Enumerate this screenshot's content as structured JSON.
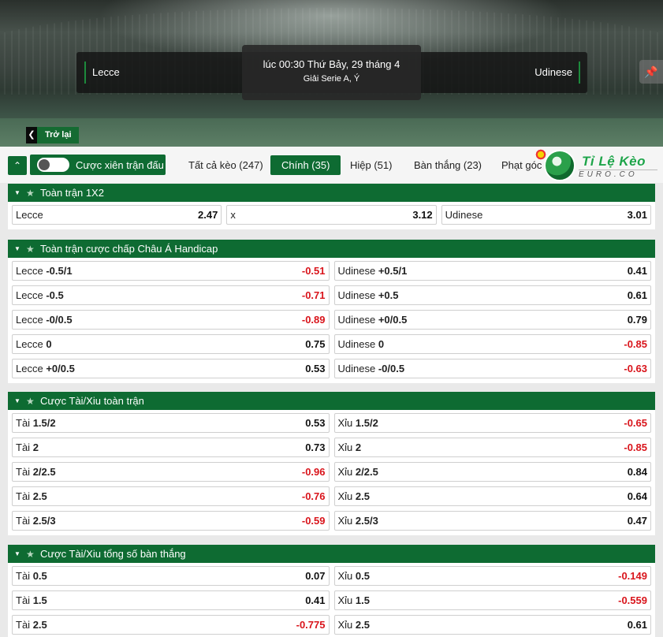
{
  "hero": {
    "home_team": "Lecce",
    "away_team": "Udinese",
    "kickoff": "lúc 00:30 Thứ Bảy, 29 tháng 4",
    "league": "Giải Serie A, Ý",
    "back_label": "Trở lại",
    "pin_icon": "pin-icon"
  },
  "toolbar": {
    "collapse_icon": "double-chevron-up-icon",
    "parlay_label": "Cược xiên trận đấu",
    "tabs": [
      {
        "label": "Tất cả kèo (247)"
      },
      {
        "label": "Chính (35)",
        "active": true
      },
      {
        "label": "Hiệp (51)"
      },
      {
        "label": "Bàn thắng (23)"
      },
      {
        "label": "Phạt góc (10)"
      }
    ]
  },
  "logo": {
    "brand": "Tỉ Lệ Kèo",
    "sub": "EURO.CO"
  },
  "colors": {
    "accent": "#0e6b32",
    "negative": "#d9141b"
  },
  "sections": [
    {
      "title": "Toàn trận 1X2",
      "cols": 3,
      "rows": [
        [
          {
            "label": "Lecce",
            "line": "",
            "odd": "2.47"
          },
          {
            "label": "x",
            "line": "",
            "odd": "3.12"
          },
          {
            "label": "Udinese",
            "line": "",
            "odd": "3.01"
          }
        ]
      ]
    },
    {
      "title": "Toàn trận cược chấp Châu Á Handicap",
      "cols": 2,
      "rows": [
        [
          {
            "label": "Lecce",
            "line": "-0.5/1",
            "odd": "-0.51"
          },
          {
            "label": "Udinese",
            "line": "+0.5/1",
            "odd": "0.41"
          }
        ],
        [
          {
            "label": "Lecce",
            "line": "-0.5",
            "odd": "-0.71"
          },
          {
            "label": "Udinese",
            "line": "+0.5",
            "odd": "0.61"
          }
        ],
        [
          {
            "label": "Lecce",
            "line": "-0/0.5",
            "odd": "-0.89"
          },
          {
            "label": "Udinese",
            "line": "+0/0.5",
            "odd": "0.79"
          }
        ],
        [
          {
            "label": "Lecce",
            "line": "0",
            "odd": "0.75"
          },
          {
            "label": "Udinese",
            "line": "0",
            "odd": "-0.85"
          }
        ],
        [
          {
            "label": "Lecce",
            "line": "+0/0.5",
            "odd": "0.53"
          },
          {
            "label": "Udinese",
            "line": "-0/0.5",
            "odd": "-0.63"
          }
        ]
      ]
    },
    {
      "title": "Cược Tài/Xiu toàn trận",
      "cols": 2,
      "rows": [
        [
          {
            "label": "Tài",
            "line": "1.5/2",
            "odd": "0.53"
          },
          {
            "label": "Xỉu",
            "line": "1.5/2",
            "odd": "-0.65"
          }
        ],
        [
          {
            "label": "Tài",
            "line": "2",
            "odd": "0.73"
          },
          {
            "label": "Xỉu",
            "line": "2",
            "odd": "-0.85"
          }
        ],
        [
          {
            "label": "Tài",
            "line": "2/2.5",
            "odd": "-0.96"
          },
          {
            "label": "Xỉu",
            "line": "2/2.5",
            "odd": "0.84"
          }
        ],
        [
          {
            "label": "Tài",
            "line": "2.5",
            "odd": "-0.76"
          },
          {
            "label": "Xỉu",
            "line": "2.5",
            "odd": "0.64"
          }
        ],
        [
          {
            "label": "Tài",
            "line": "2.5/3",
            "odd": "-0.59"
          },
          {
            "label": "Xỉu",
            "line": "2.5/3",
            "odd": "0.47"
          }
        ]
      ]
    },
    {
      "title": "Cược Tài/Xiu tổng số bàn thắng",
      "cols": 2,
      "rows": [
        [
          {
            "label": "Tài",
            "line": "0.5",
            "odd": "0.07"
          },
          {
            "label": "Xỉu",
            "line": "0.5",
            "odd": "-0.149"
          }
        ],
        [
          {
            "label": "Tài",
            "line": "1.5",
            "odd": "0.41"
          },
          {
            "label": "Xỉu",
            "line": "1.5",
            "odd": "-0.559"
          }
        ],
        [
          {
            "label": "Tài",
            "line": "2.5",
            "odd": "-0.775"
          },
          {
            "label": "Xỉu",
            "line": "2.5",
            "odd": "0.61"
          }
        ]
      ]
    }
  ]
}
